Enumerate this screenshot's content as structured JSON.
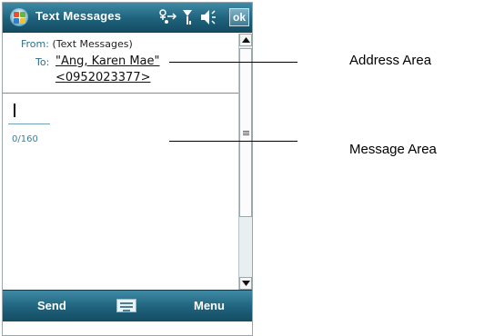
{
  "titlebar": {
    "app_title": "Text Messages",
    "ok_label": "ok",
    "icons": [
      "start-icon",
      "connectivity-icon",
      "signal-icon",
      "volume-icon"
    ]
  },
  "header": {
    "from_label": "From:",
    "from_value": "(Text Messages)",
    "to_label": "To:",
    "to_line_1": "\"Ang, Karen Mae\"",
    "to_line_2": "<0952023377>"
  },
  "message": {
    "char_count": "0/160"
  },
  "softkeys": {
    "left": "Send",
    "right": "Menu",
    "center_icon": "keyboard-icon"
  },
  "annotations": {
    "address_area": "Address Area",
    "message_area": "Message Area"
  },
  "colors": {
    "titlebar": "#1f627c",
    "label_accent": "#2f6f89"
  }
}
